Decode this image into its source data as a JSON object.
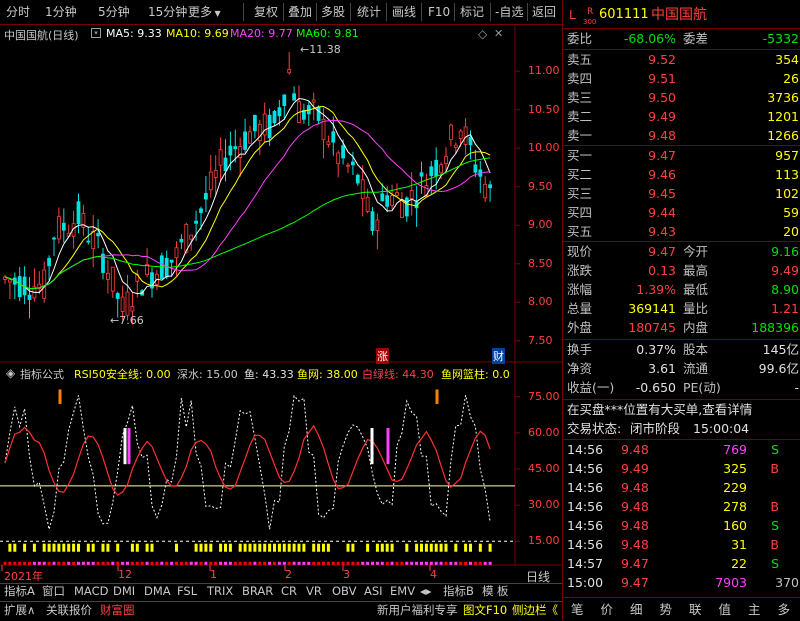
{
  "toolbar": {
    "left": [
      "分时",
      "1分钟",
      "5分钟",
      "15分钟",
      "更多"
    ],
    "right": [
      "复权",
      "叠加",
      "多股",
      "统计",
      "画线",
      "F10",
      "标记",
      "-自选",
      "返回"
    ]
  },
  "kline": {
    "title": "中国国航(日线)",
    "ma5": "MA5: 9.33",
    "ma10": "MA10: 9.69",
    "ma20": "MA20: 9.77",
    "ma60": "MA60: 9.81",
    "high_label": "11.38",
    "low_label": "7.66",
    "y_ticks": [
      "11.00",
      "10.50",
      "10.00",
      "9.50",
      "9.00",
      "8.50",
      "8.00",
      "7.50"
    ],
    "marker_zhang": "涨",
    "marker_cai": "财"
  },
  "indicator": {
    "name": "指标公式",
    "rsi_line": "RSI50安全线: 0.00",
    "shenshui": "深水: 15.00",
    "yu": "鱼: 43.33",
    "yuwang": "鱼网: 38.00",
    "baixian": "白绿线: 44.30",
    "lanzhu": "鱼网篮柱: 0.0",
    "y_ticks": [
      "75.00",
      "60.00",
      "45.00",
      "30.00",
      "15.00"
    ]
  },
  "xaxis": {
    "labels": [
      "2021年",
      "12",
      "1",
      "2",
      "3",
      "4"
    ],
    "period": "日线"
  },
  "bottom_tabs": [
    "指标A",
    "窗口",
    "MACD",
    "DMI",
    "DMA",
    "FSL",
    "TRIX",
    "BRAR",
    "CR",
    "VR",
    "OBV",
    "ASI",
    "EMV",
    "指标B",
    "模",
    "板"
  ],
  "bottom_row2": {
    "left": [
      "扩展∧",
      "关联报价",
      "财富圈"
    ],
    "right": [
      "新用户福利专享",
      "图文F10",
      "侧边栏《"
    ]
  },
  "quote": {
    "code": "601111",
    "name": "中国国航",
    "tag_l": "L",
    "tag_r": "R",
    "tag_300": "300",
    "weibi_label": "委比",
    "weibi": "-68.06%",
    "weicha_label": "委差",
    "weicha": "-5332",
    "asks": [
      {
        "label": "卖五",
        "price": "9.52",
        "vol": "354"
      },
      {
        "label": "卖四",
        "price": "9.51",
        "vol": "26"
      },
      {
        "label": "卖三",
        "price": "9.50",
        "vol": "3736"
      },
      {
        "label": "卖二",
        "price": "9.49",
        "vol": "1201"
      },
      {
        "label": "卖一",
        "price": "9.48",
        "vol": "1266"
      }
    ],
    "bids": [
      {
        "label": "买一",
        "price": "9.47",
        "vol": "957"
      },
      {
        "label": "买二",
        "price": "9.46",
        "vol": "113"
      },
      {
        "label": "买三",
        "price": "9.45",
        "vol": "102"
      },
      {
        "label": "买四",
        "price": "9.44",
        "vol": "59"
      },
      {
        "label": "买五",
        "price": "9.43",
        "vol": "20"
      }
    ],
    "stats": [
      {
        "l1": "现价",
        "v1": "9.47",
        "l2": "今开",
        "v2": "9.16"
      },
      {
        "l1": "涨跌",
        "v1": "0.13",
        "l2": "最高",
        "v2": "9.49"
      },
      {
        "l1": "涨幅",
        "v1": "1.39%",
        "l2": "最低",
        "v2": "8.90"
      },
      {
        "l1": "总量",
        "v1": "369141",
        "l2": "量比",
        "v2": "1.21"
      },
      {
        "l1": "外盘",
        "v1": "180745",
        "l2": "内盘",
        "v2": "188396"
      }
    ],
    "stats2": [
      {
        "l1": "换手",
        "v1": "0.37%",
        "l2": "股本",
        "v2": "145亿"
      },
      {
        "l1": "净资",
        "v1": "3.61",
        "l2": "流通",
        "v2": "99.6亿"
      },
      {
        "l1": "收益(一)",
        "v1": "-0.650",
        "l2": "PE(动)",
        "v2": "-"
      }
    ],
    "notice": "在买盘***位置有大买单,查看详情",
    "status_label": "交易状态:",
    "status": "闭市阶段",
    "status_time": "15:00:04",
    "ticks": [
      {
        "t": "14:56",
        "p": "9.48",
        "v": "769",
        "bs": "S"
      },
      {
        "t": "14:56",
        "p": "9.49",
        "v": "325",
        "bs": "B"
      },
      {
        "t": "14:56",
        "p": "9.48",
        "v": "229",
        "bs": ""
      },
      {
        "t": "14:56",
        "p": "9.48",
        "v": "278",
        "bs": "B"
      },
      {
        "t": "14:56",
        "p": "9.48",
        "v": "160",
        "bs": "S"
      },
      {
        "t": "14:56",
        "p": "9.48",
        "v": "31",
        "bs": "B"
      },
      {
        "t": "14:57",
        "p": "9.47",
        "v": "22",
        "bs": "S"
      },
      {
        "t": "15:00",
        "p": "9.47",
        "v": "7903",
        "bs": "370"
      }
    ],
    "nav": [
      "笔",
      "价",
      "细",
      "势",
      "联",
      "值",
      "主",
      "多"
    ]
  },
  "colors": {
    "up": "#ff4040",
    "down": "#00e0e0",
    "ma5": "#ffffff",
    "ma10": "#ffff00",
    "ma20": "#ff40ff",
    "ma60": "#00ff00",
    "border": "#7a0000"
  }
}
